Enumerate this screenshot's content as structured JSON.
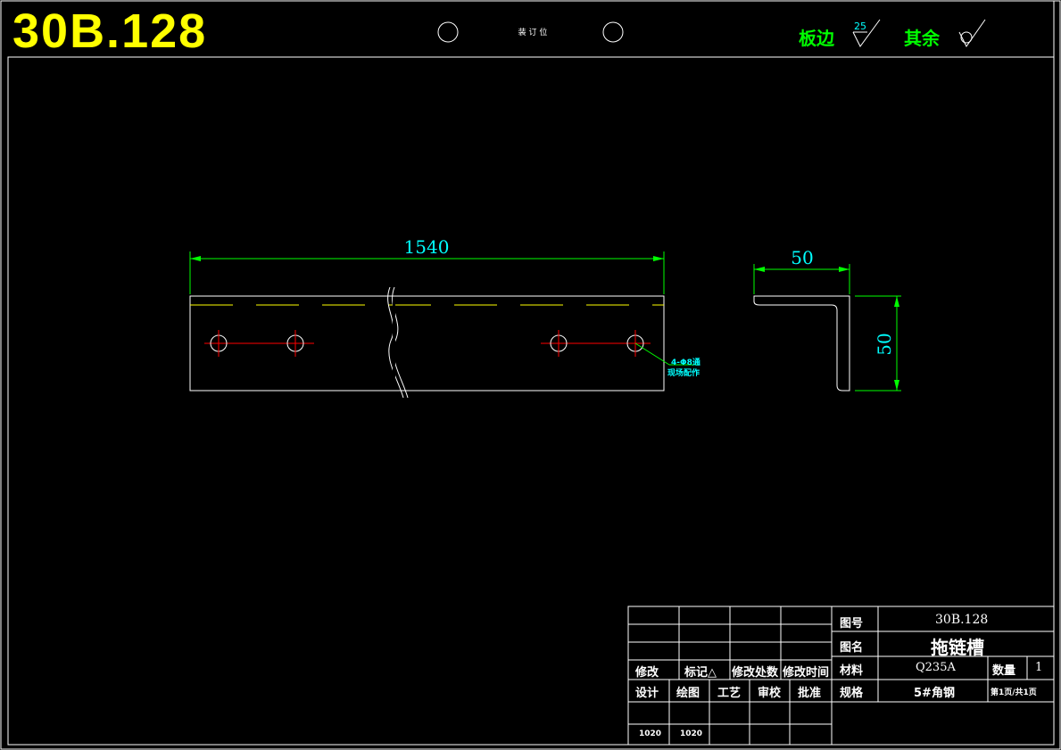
{
  "header": {
    "drawing_code": "30B.128",
    "binding_label": "装 订 位",
    "plate_edge_label": "板边",
    "plate_edge_roughness": "25",
    "others_label": "其余"
  },
  "front_view": {
    "length_dim": "1540",
    "hole_note_line1": "4-Φ8通",
    "hole_note_line2": "现场配作"
  },
  "side_view": {
    "width_dim": "50",
    "height_dim": "50"
  },
  "title_block": {
    "rev_labels": [
      "修改",
      "标记△",
      "修改处数",
      "修改时间"
    ],
    "sign_labels": [
      "设计",
      "绘图",
      "工艺",
      "审校",
      "批准"
    ],
    "dates": [
      "1020",
      "1020"
    ],
    "drawing_no_label": "图号",
    "drawing_no": "30B.128",
    "name_label": "图名",
    "name": "拖链槽",
    "material_label": "材料",
    "material": "Q235A",
    "qty_label": "数量",
    "qty": "1",
    "spec_label": "规格",
    "spec": "5#角钢",
    "page": "第1页/共1页"
  },
  "colors": {
    "background": "#000000",
    "outline": "#ffffff",
    "dimension": "#00ff00",
    "dimension_text": "#00ffff",
    "center_line": "#ff0000",
    "hidden_line": "#ffff00",
    "title": "#ffff00",
    "roughness_label": "#00ff00"
  }
}
